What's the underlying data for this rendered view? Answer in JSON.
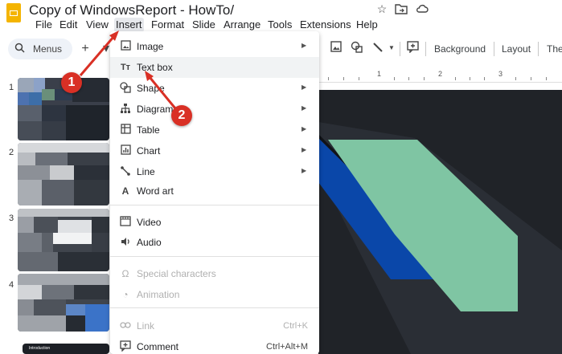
{
  "app": {
    "title": "Copy of WindowsReport - HowTo/",
    "icons": [
      "star-icon",
      "move-to-folder-icon",
      "cloud-status-icon"
    ]
  },
  "menubar": {
    "items": [
      "File",
      "Edit",
      "View",
      "Insert",
      "Format",
      "Slide",
      "Arrange",
      "Tools",
      "Extensions",
      "Help"
    ],
    "active": "Insert"
  },
  "toolbar": {
    "search_label": "Menus",
    "background_label": "Background",
    "layout_label": "Layout",
    "theme_label": "The"
  },
  "ruler": {
    "marks": [
      "1",
      "2",
      "3"
    ]
  },
  "slides": {
    "numbers": [
      "1",
      "2",
      "3",
      "4"
    ],
    "thumb5_text": "Introduction"
  },
  "insert_menu": {
    "items": [
      {
        "label": "Image",
        "icon": "image-icon",
        "submenu": true,
        "disabled": false,
        "shortcut": ""
      },
      {
        "label": "Text box",
        "icon": "text-box-icon",
        "submenu": false,
        "disabled": false,
        "shortcut": ""
      },
      {
        "label": "Shape",
        "icon": "shape-icon",
        "submenu": true,
        "disabled": false,
        "shortcut": ""
      },
      {
        "label": "Diagram",
        "icon": "diagram-icon",
        "submenu": true,
        "disabled": false,
        "shortcut": ""
      },
      {
        "label": "Table",
        "icon": "table-icon",
        "submenu": true,
        "disabled": false,
        "shortcut": ""
      },
      {
        "label": "Chart",
        "icon": "chart-icon",
        "submenu": true,
        "disabled": false,
        "shortcut": ""
      },
      {
        "label": "Line",
        "icon": "line-icon",
        "submenu": true,
        "disabled": false,
        "shortcut": ""
      },
      {
        "label": "Word art",
        "icon": "word-art-icon",
        "submenu": false,
        "disabled": false,
        "shortcut": ""
      },
      {
        "label": "Video",
        "icon": "video-icon",
        "submenu": false,
        "disabled": false,
        "shortcut": ""
      },
      {
        "label": "Audio",
        "icon": "audio-icon",
        "submenu": false,
        "disabled": false,
        "shortcut": ""
      },
      {
        "label": "Special characters",
        "icon": "omega-icon",
        "submenu": false,
        "disabled": true,
        "shortcut": ""
      },
      {
        "label": "Animation",
        "icon": "animation-icon",
        "submenu": false,
        "disabled": true,
        "shortcut": ""
      },
      {
        "label": "Link",
        "icon": "link-icon",
        "submenu": false,
        "disabled": true,
        "shortcut": "Ctrl+K"
      },
      {
        "label": "Comment",
        "icon": "comment-icon",
        "submenu": false,
        "disabled": false,
        "shortcut": "Ctrl+Alt+M"
      }
    ]
  },
  "annotations": [
    "1",
    "2"
  ],
  "colors": {
    "app_accent": "#f4b400",
    "callout": "#d93025",
    "canvas_bg": "#202328",
    "slide_blue": "#0a47a9",
    "slide_green": "#7fc5a3"
  }
}
